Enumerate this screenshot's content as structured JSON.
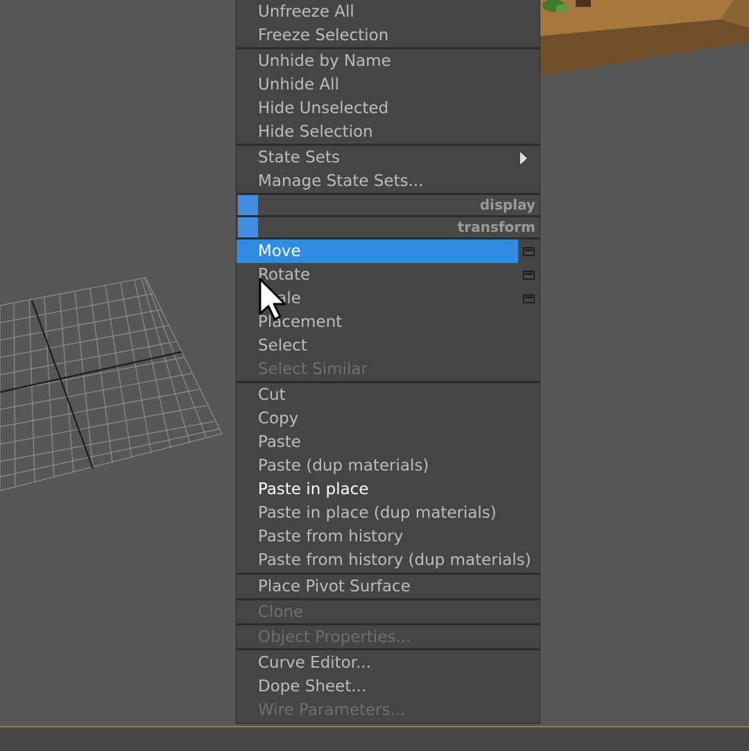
{
  "colors": {
    "highlight": "#2f8ce0",
    "menu_bg": "#454545",
    "viewport_bg": "#565656",
    "text_normal": "#bcbcbc",
    "text_disabled": "#6f6f6f"
  },
  "menu": {
    "group_1": [
      "Unfreeze All",
      "Freeze Selection"
    ],
    "group_2": [
      "Unhide by Name",
      "Unhide All",
      "Hide Unselected",
      "Hide Selection"
    ],
    "group_3": {
      "state_sets": "State Sets",
      "manage_state_sets": "Manage State Sets..."
    },
    "quad_display": "display",
    "quad_transform": "transform",
    "transform_items": {
      "move": "Move",
      "rotate": "Rotate",
      "scale": "Scale",
      "placement": "Placement",
      "select": "Select",
      "select_similar": "Select Similar"
    },
    "edit_items": {
      "cut": "Cut",
      "copy": "Copy",
      "paste": "Paste",
      "paste_dup": "Paste (dup materials)",
      "paste_in_place": "Paste in place",
      "paste_in_place_dup": "Paste in place (dup materials)",
      "paste_from_history": "Paste from history",
      "paste_from_history_dup": "Paste from history (dup materials)"
    },
    "place_pivot_surface": "Place Pivot Surface",
    "clone": "Clone",
    "object_properties": "Object Properties...",
    "curve_editor": "Curve Editor...",
    "dope_sheet": "Dope Sheet...",
    "wire_parameters": "Wire Parameters..."
  },
  "icons": {
    "submenu": "chevron-right-icon",
    "options": "settings-box-icon",
    "cursor": "mouse-pointer-icon"
  }
}
